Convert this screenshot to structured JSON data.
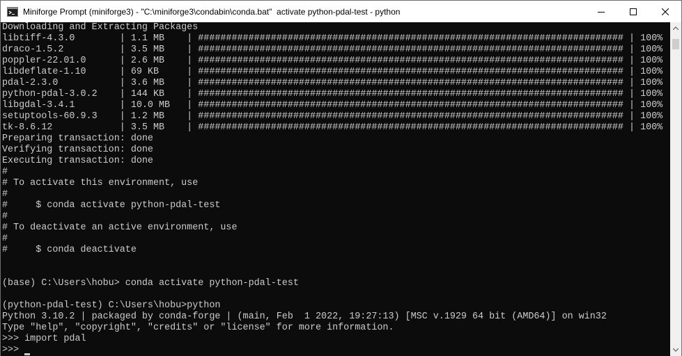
{
  "window": {
    "title": "Miniforge Prompt (miniforge3) - \"C:\\miniforge3\\condabin\\conda.bat\"  activate python-pdal-test - python",
    "icon": "terminal-icon",
    "controls": {
      "minimize": "minimize-icon",
      "maximize": "maximize-icon",
      "close": "close-icon"
    }
  },
  "terminal": {
    "lines": [
      "Downloading and Extracting Packages",
      "libtiff-4.3.0        | 1.1 MB    | ############################################################################ | 100%",
      "draco-1.5.2          | 3.5 MB    | ############################################################################ | 100%",
      "poppler-22.01.0      | 2.6 MB    | ############################################################################ | 100%",
      "libdeflate-1.10      | 69 KB     | ############################################################################ | 100%",
      "pdal-2.3.0           | 3.6 MB    | ############################################################################ | 100%",
      "python-pdal-3.0.2    | 144 KB    | ############################################################################ | 100%",
      "libgdal-3.4.1        | 10.0 MB   | ############################################################################ | 100%",
      "setuptools-60.9.3    | 1.2 MB    | ############################################################################ | 100%",
      "tk-8.6.12            | 3.5 MB    | ############################################################################ | 100%",
      "Preparing transaction: done",
      "Verifying transaction: done",
      "Executing transaction: done",
      "#",
      "# To activate this environment, use",
      "#",
      "#     $ conda activate python-pdal-test",
      "#",
      "# To deactivate an active environment, use",
      "#",
      "#     $ conda deactivate",
      "",
      "",
      "(base) C:\\Users\\hobu> conda activate python-pdal-test",
      "",
      "(python-pdal-test) C:\\Users\\hobu>python",
      "Python 3.10.2 | packaged by conda-forge | (main, Feb  1 2022, 19:27:13) [MSC v.1929 64 bit (AMD64)] on win32",
      "Type \"help\", \"copyright\", \"credits\" or \"license\" for more information.",
      ">>> import pdal"
    ],
    "prompt": ">>> "
  },
  "scrollbar": {
    "up_icon": "scroll-up-icon",
    "down_icon": "scroll-down-icon"
  }
}
